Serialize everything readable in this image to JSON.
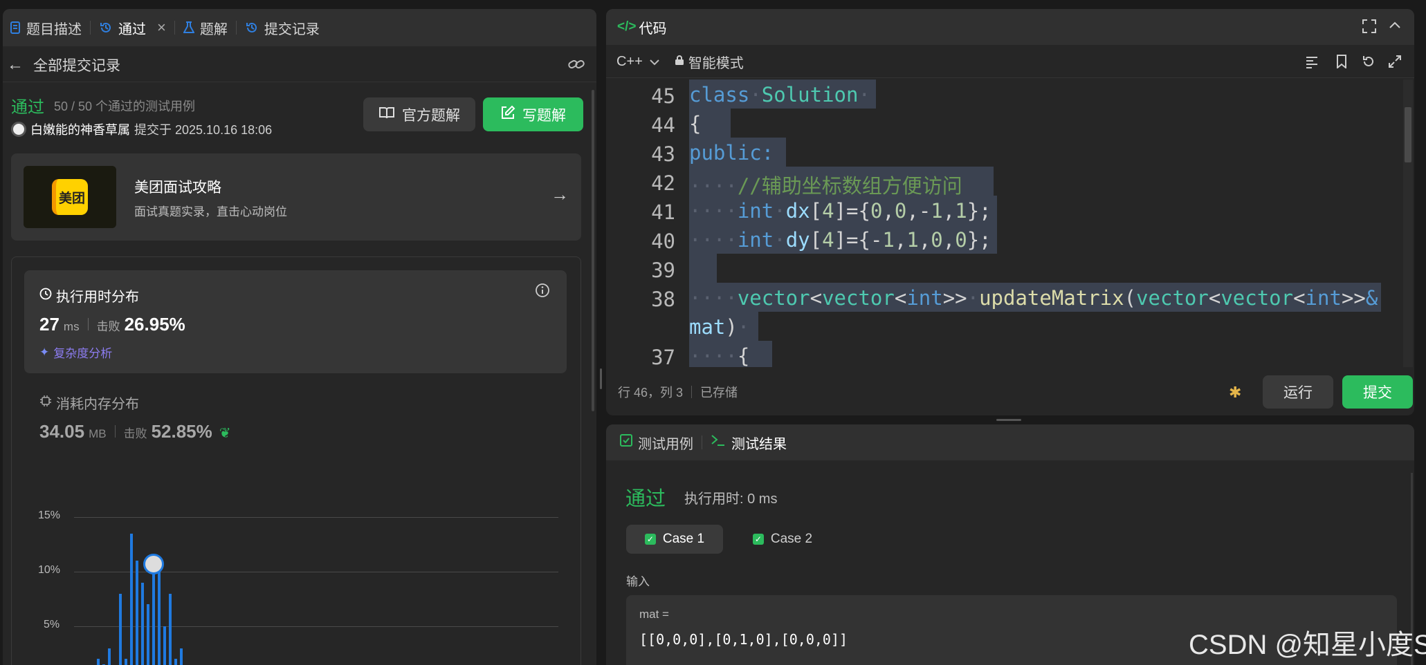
{
  "colors": {
    "accent_green": "#2cbb5d",
    "bar_blue": "#1f7ae0",
    "panel": "#262626"
  },
  "left_tabs": [
    {
      "label": "题目描述",
      "icon": "description-icon"
    },
    {
      "label": "通过",
      "icon": "history-icon",
      "active": true,
      "closable": true
    },
    {
      "label": "题解",
      "icon": "flask-icon"
    },
    {
      "label": "提交记录",
      "icon": "history-icon"
    }
  ],
  "submissions_back": "全部提交记录",
  "result": {
    "status": "通过",
    "cases": "50 / 50 个通过的测试用例",
    "user": "白嫩能的神香草属",
    "submitted": "提交于 2025.10.16 18:06",
    "official_solution": "官方题解",
    "write_solution": "写题解"
  },
  "promo": {
    "logo_text": "美团",
    "title": "美团面试攻略",
    "subtitle": "面试真题实录，直击心动岗位"
  },
  "runtime": {
    "title": "执行用时分布",
    "value": "27",
    "unit": "ms",
    "beats_label": "击败",
    "beats": "26.95%",
    "complexity": "复杂度分析"
  },
  "memory": {
    "title": "消耗内存分布",
    "value": "34.05",
    "unit": "MB",
    "beats_label": "击败",
    "beats": "52.85%"
  },
  "chart_data": {
    "type": "bar",
    "yticks": [
      "15%",
      "10%",
      "5%"
    ],
    "ylim": [
      0,
      15
    ],
    "values": [
      0.5,
      2,
      1.5,
      3,
      1,
      8,
      2,
      13.5,
      11,
      9,
      7,
      10.5,
      11,
      5,
      8,
      2,
      3,
      1,
      0.5
    ],
    "marker_index": 11
  },
  "code": {
    "title": "代码",
    "language": "C++",
    "mode": "智能模式",
    "status": "行 46，列 3",
    "saved": "已存储",
    "run": "运行",
    "submit": "提交",
    "line_numbers": [
      "45",
      "44",
      "43",
      "42",
      "41",
      "40",
      "39",
      "38",
      "",
      "37"
    ]
  },
  "tests": {
    "tab_cases": "测试用例",
    "tab_result": "测试结果",
    "status": "通过",
    "runtime": "执行用时: 0 ms",
    "case1": "Case 1",
    "case2": "Case 2",
    "input_label": "输入",
    "var_name": "mat =",
    "var_value": "[[0,0,0],[0,1,0],[0,0,0]]"
  },
  "watermark": "CSDN @知星小度S"
}
